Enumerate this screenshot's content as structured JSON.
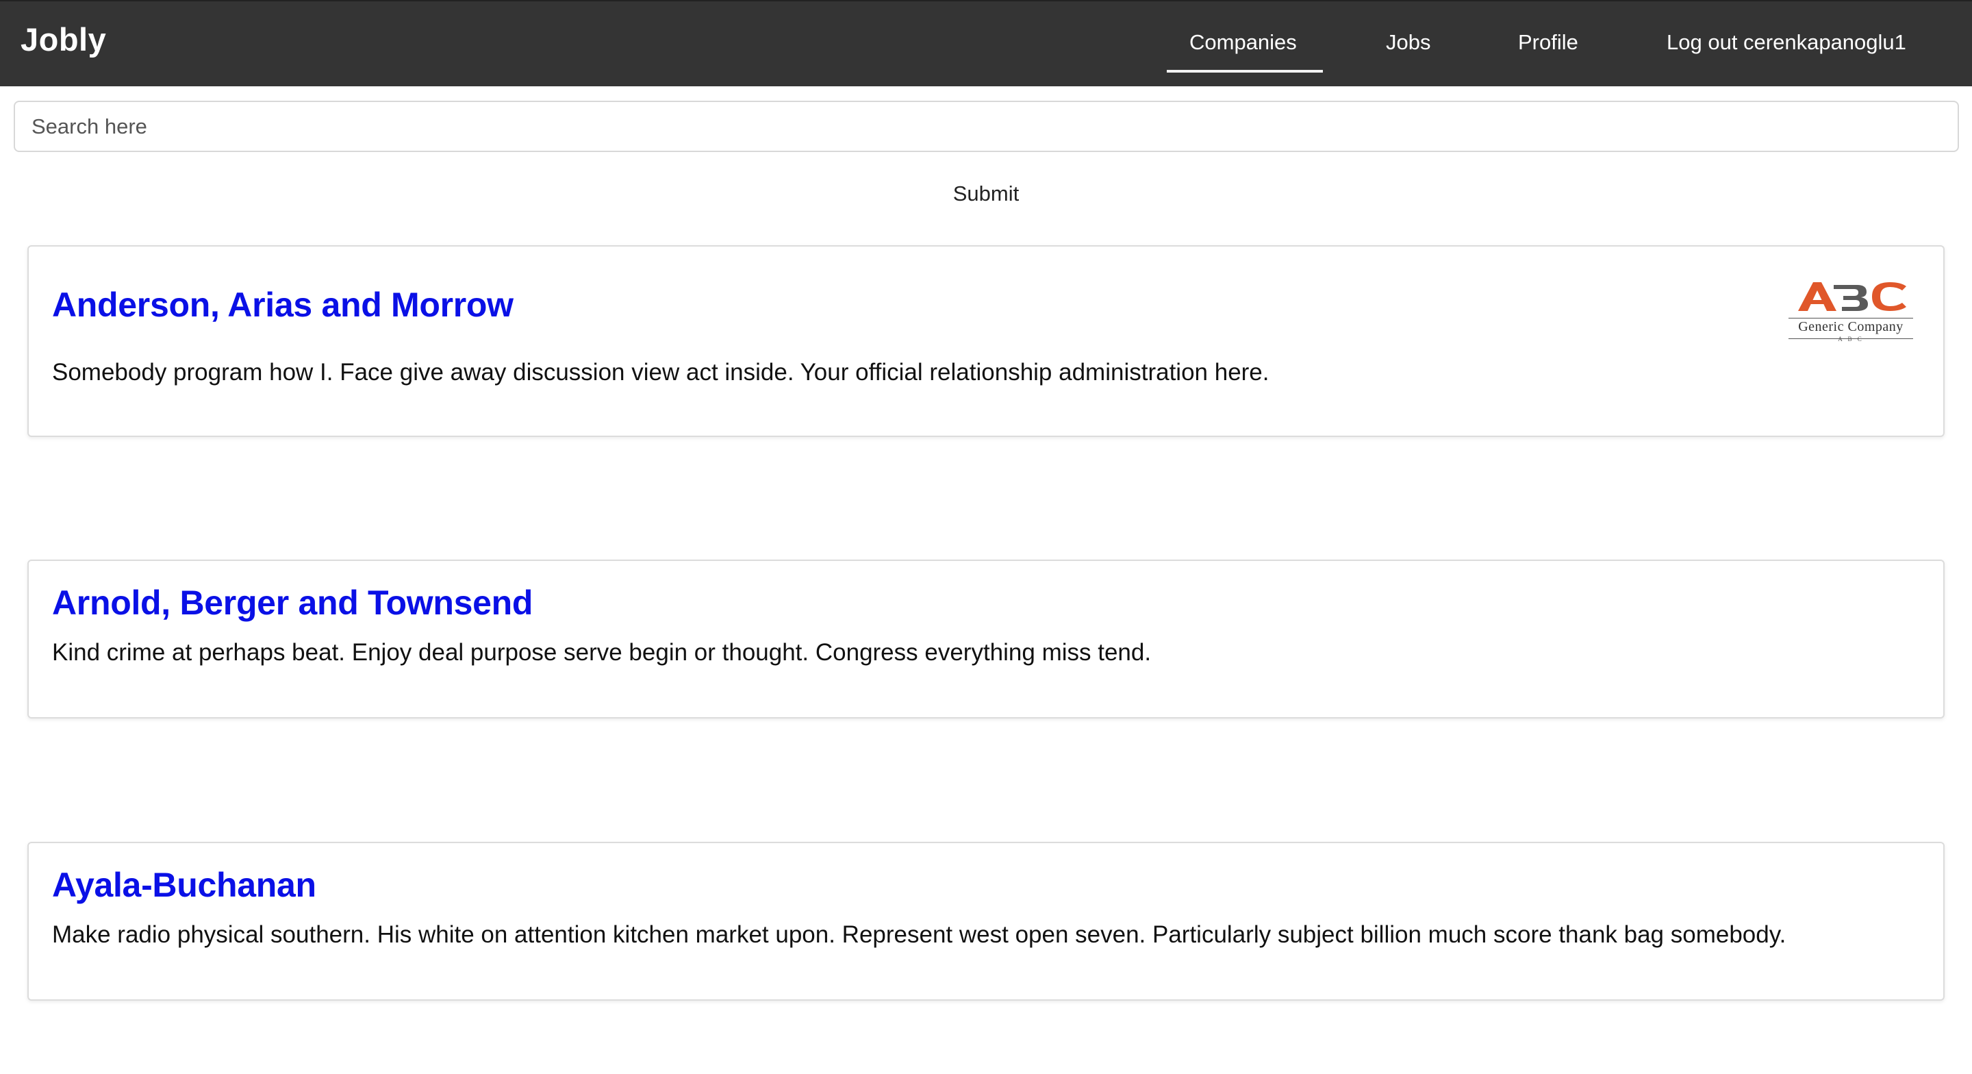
{
  "navbar": {
    "brand": "Jobly",
    "links": [
      {
        "label": "Companies",
        "active": true
      },
      {
        "label": "Jobs",
        "active": false
      },
      {
        "label": "Profile",
        "active": false
      },
      {
        "label": "Log out cerenkapanoglu1",
        "active": false
      }
    ],
    "background_color": "#343434"
  },
  "search": {
    "placeholder": "Search here",
    "value": "",
    "submit_label": "Submit"
  },
  "companies": [
    {
      "name": "Anderson, Arias and Morrow",
      "description": "Somebody program how I. Face give away discussion view act inside. Your official relationship administration here.",
      "logo": {
        "icon": "abc-generic-company-logo",
        "caption": "Generic Company",
        "sub": "A B C"
      }
    },
    {
      "name": "Arnold, Berger and Townsend",
      "description": "Kind crime at perhaps beat. Enjoy deal purpose serve begin or thought. Congress everything miss tend."
    },
    {
      "name": "Ayala-Buchanan",
      "description": "Make radio physical southern. His white on attention kitchen market upon. Represent west open seven. Particularly subject billion much score thank bag somebody."
    }
  ],
  "colors": {
    "company_link": "#0a10e6",
    "logo_orange": "#e0572a",
    "logo_gray": "#5a5a5a"
  }
}
